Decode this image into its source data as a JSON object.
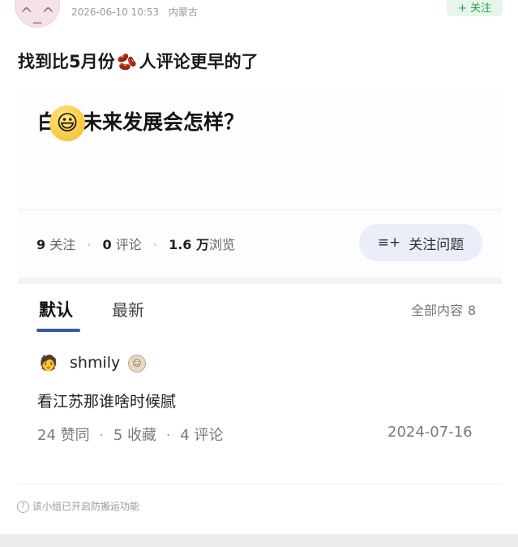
{
  "top": {
    "date": "2026-06-10 10:53",
    "location": "内蒙古",
    "follow_label": "+ 关注"
  },
  "post": {
    "title_before": "找到比5月份",
    "title_after": "人评论更早的了"
  },
  "question": {
    "title_start": "白",
    "title_end": "未来发展会怎样？",
    "follows_count": "9",
    "follows_label": "关注",
    "comments_count": "0",
    "comments_label": "评论",
    "views_count": "1.6 万",
    "views_label": "浏览",
    "follow_question_label": "关注问题"
  },
  "answers": {
    "tab_default": "默认",
    "tab_latest": "最新",
    "all_content_label": "全部内容",
    "all_content_count": "8",
    "item": {
      "username": "shmily",
      "text": "看江苏那谁啥时候腻",
      "likes": "24 赞同",
      "favorites": "5 收藏",
      "comments": "4 评论",
      "date": "2024-07-16"
    }
  },
  "footer": {
    "notice": "该小组已开启防搬运功能"
  },
  "icons": {
    "bean": "bean-emoji",
    "smiley": "grinning-face-emoji",
    "follow_question": "add-list-icon",
    "help": "question-circle-icon"
  },
  "colors": {
    "accent_green": "#2ca34b",
    "tab_indicator": "#3b5a9a",
    "follow_question_bg": "#e9eef8"
  }
}
